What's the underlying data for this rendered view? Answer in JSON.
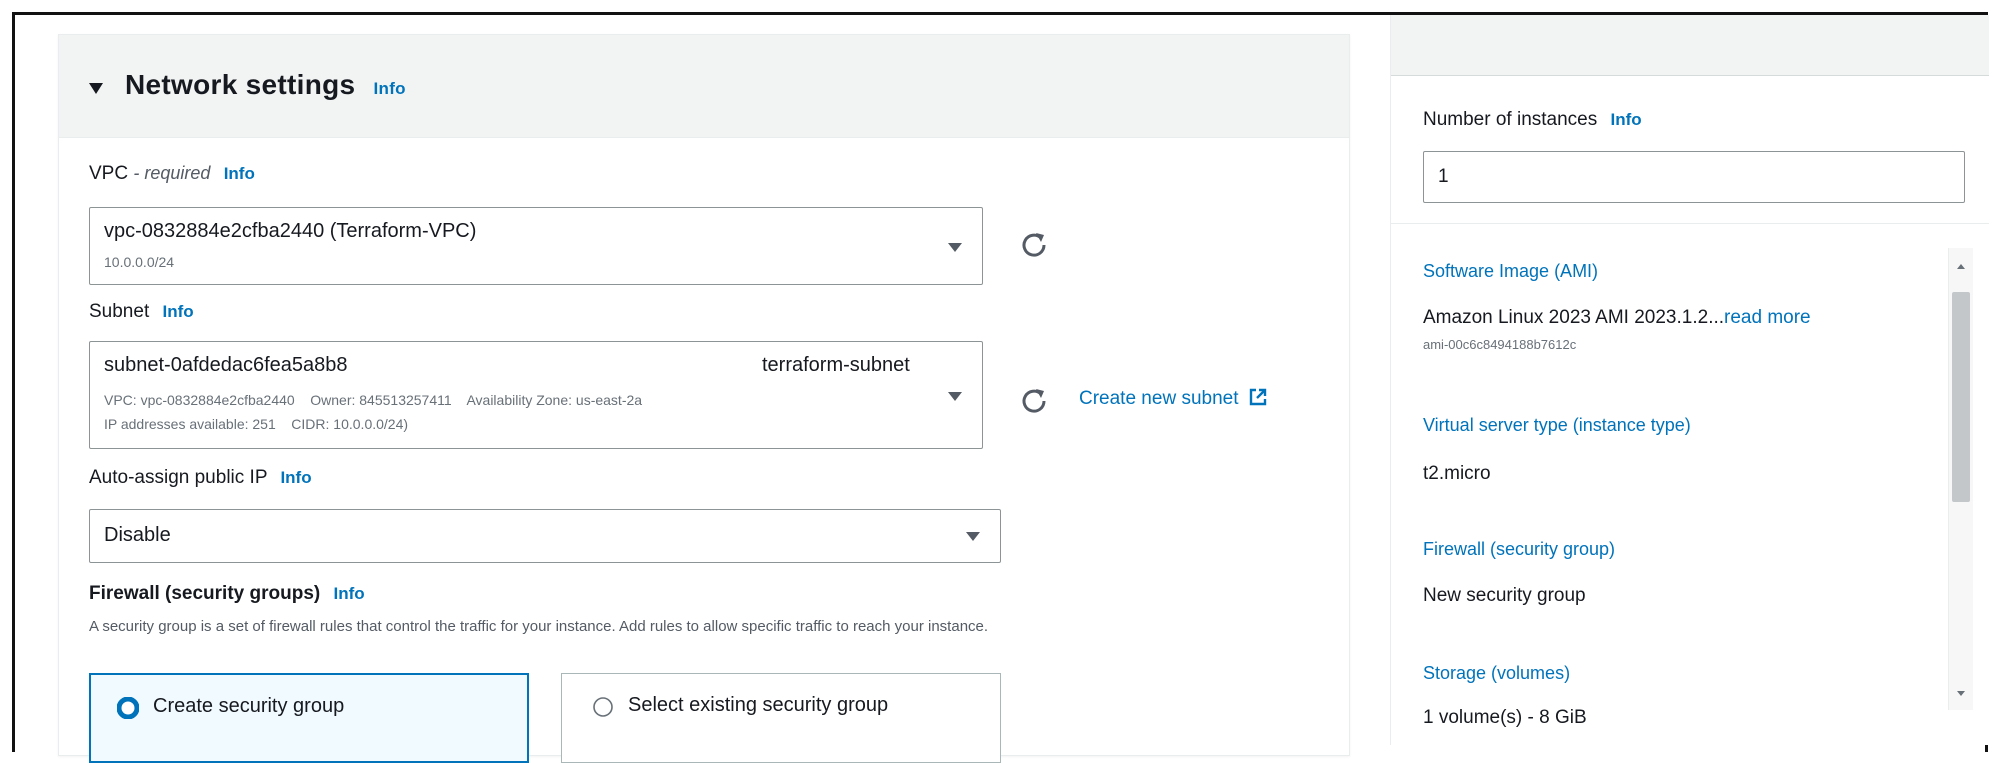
{
  "network": {
    "title": "Network settings",
    "info": "Info"
  },
  "vpc": {
    "label": "VPC",
    "required": "- required",
    "info": "Info",
    "value": "vpc-0832884e2cfba2440 (Terraform-VPC)",
    "cidr": "10.0.0.0/24"
  },
  "subnet": {
    "label": "Subnet",
    "info": "Info",
    "value": "subnet-0afdedac6fea5a8b8",
    "name": "terraform-subnet",
    "details1": "VPC: vpc-0832884e2cfba2440    Owner: 845513257411    Availability Zone: us-east-2a",
    "details2": "IP addresses available: 251    CIDR: 10.0.0.0/24)",
    "create_link": "Create new subnet"
  },
  "public_ip": {
    "label": "Auto-assign public IP",
    "info": "Info",
    "value": "Disable"
  },
  "firewall": {
    "label": "Firewall (security groups)",
    "info": "Info",
    "description": "A security group is a set of firewall rules that control the traffic for your instance. Add rules to allow specific traffic to reach your instance.",
    "option_create": "Create security group",
    "option_existing": "Select existing security group",
    "selected": "create"
  },
  "summary": {
    "instances_label": "Number of instances",
    "instances_info": "Info",
    "instances_value": "1",
    "ami_label": "Software Image (AMI)",
    "ami_value": "Amazon Linux 2023 AMI 2023.1.2...",
    "ami_read_more": "read more",
    "ami_id": "ami-00c6c8494188b7612c",
    "type_label": "Virtual server type (instance type)",
    "type_value": "t2.micro",
    "firewall_label": "Firewall (security group)",
    "firewall_value": "New security group",
    "storage_label": "Storage (volumes)",
    "storage_value": "1 volume(s) - 8 GiB"
  },
  "colors": {
    "link": "#0073bb",
    "radio_selected": "#0073bb",
    "header_bg": "#f2f3f3"
  }
}
